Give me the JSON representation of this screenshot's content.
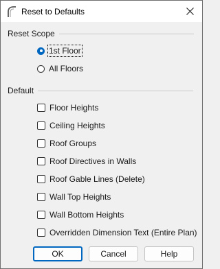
{
  "window": {
    "title": "Reset to Defaults",
    "icon": "arch-app-icon",
    "close_icon": "close-icon"
  },
  "reset_scope": {
    "label": "Reset Scope",
    "options": [
      {
        "label": "1st Floor",
        "selected": true
      },
      {
        "label": "All Floors",
        "selected": false
      }
    ]
  },
  "default": {
    "label": "Default",
    "items": [
      {
        "label": "Floor Heights",
        "checked": false
      },
      {
        "label": "Ceiling Heights",
        "checked": false
      },
      {
        "label": "Roof Groups",
        "checked": false
      },
      {
        "label": "Roof Directives in Walls",
        "checked": false
      },
      {
        "label": "Roof Gable Lines (Delete)",
        "checked": false
      },
      {
        "label": "Wall Top Heights",
        "checked": false
      },
      {
        "label": "Wall Bottom Heights",
        "checked": false
      },
      {
        "label": "Overridden Dimension Text (Entire Plan)",
        "checked": false
      }
    ]
  },
  "buttons": {
    "ok": "OK",
    "cancel": "Cancel",
    "help": "Help"
  },
  "colors": {
    "accent": "#0067c0",
    "background": "#f0f0f0",
    "titlebar": "#ffffff"
  }
}
